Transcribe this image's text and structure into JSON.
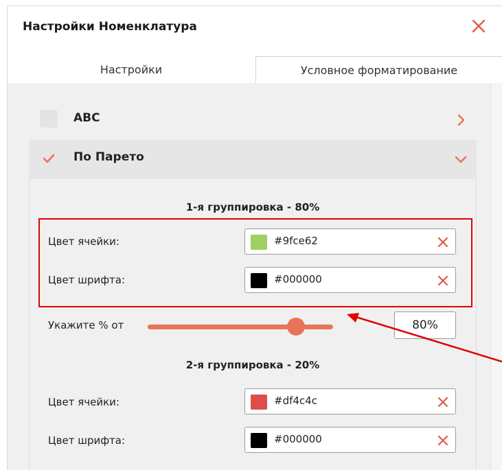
{
  "dialog": {
    "title": "Настройки Номенклатура"
  },
  "tabs": [
    {
      "label": "Настройки",
      "active": false
    },
    {
      "label": "Условное форматирование",
      "active": true
    }
  ],
  "sections": {
    "abc": {
      "label": "ABC",
      "checked": false,
      "expanded": false
    },
    "pareto": {
      "label": "По Парето",
      "checked": true,
      "expanded": true
    }
  },
  "group1": {
    "title": "1-я группировка - 80%",
    "cell_color": {
      "label": "Цвет ячейки:",
      "value": "#9fce62",
      "swatch": "#9fce62"
    },
    "font_color": {
      "label": "Цвет шрифта:",
      "value": "#000000",
      "swatch": "#000000"
    }
  },
  "slider": {
    "label": "Укажите % от",
    "value_percent": 80,
    "display": "80%"
  },
  "group2": {
    "title": "2-я группировка - 20%",
    "cell_color": {
      "label": "Цвет ячейки:",
      "value": "#df4c4c",
      "swatch": "#df4c4c"
    },
    "font_color": {
      "label": "Цвет шрифта:",
      "value": "#000000",
      "swatch": "#000000"
    }
  },
  "colors": {
    "accent": "#e8735a",
    "close": "#e05a4a",
    "highlight": "#e00000"
  },
  "icons": {
    "close": "close-icon",
    "chevron_right": "chevron-right-icon",
    "chevron_down": "chevron-down-icon",
    "check": "check-icon",
    "clear": "clear-icon"
  }
}
